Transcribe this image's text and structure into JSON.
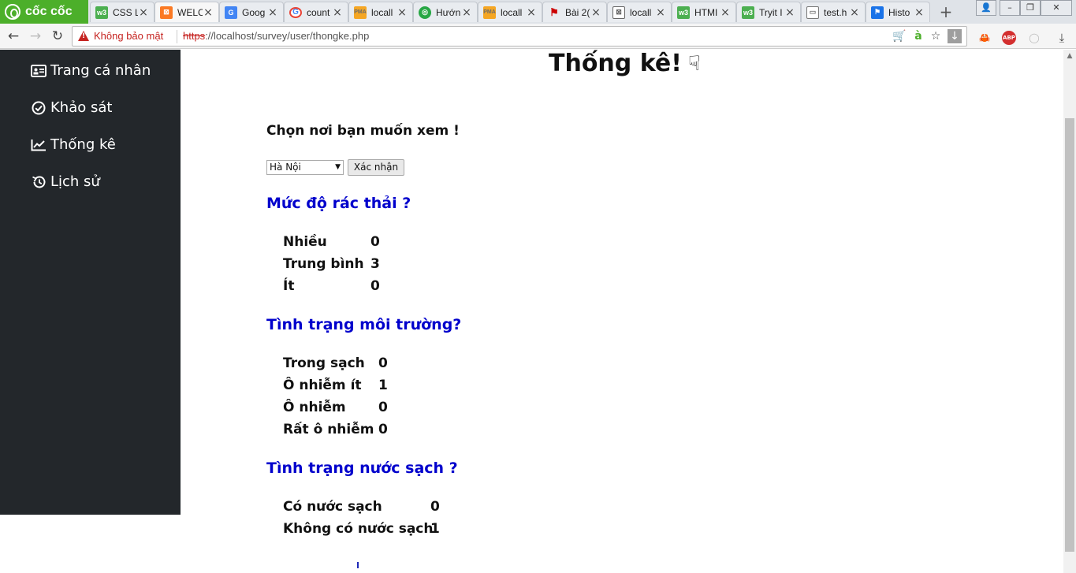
{
  "browser": {
    "brand": "cốc cốc",
    "tabs": [
      {
        "title": "CSS L",
        "favicon": "w3"
      },
      {
        "title": "WELC",
        "favicon": "xampp"
      },
      {
        "title": "Goog",
        "favicon": "gdoc"
      },
      {
        "title": "count",
        "favicon": "google"
      },
      {
        "title": "locall",
        "favicon": "pma"
      },
      {
        "title": "Hướn",
        "favicon": "guide"
      },
      {
        "title": "locall",
        "favicon": "pma"
      },
      {
        "title": "Bài 2(",
        "favicon": "flag-red"
      },
      {
        "title": "locall",
        "favicon": "xbox"
      },
      {
        "title": "HTMI",
        "favicon": "w3"
      },
      {
        "title": "Tryit I",
        "favicon": "w3"
      },
      {
        "title": "test.h",
        "favicon": "doc"
      },
      {
        "title": "Histo",
        "favicon": "flag-blue"
      }
    ],
    "active_tab": 1,
    "security_label": "Không bảo mật",
    "url_scheme": "https",
    "url_rest": "://localhost/survey/user/thongke.php"
  },
  "sidebar": {
    "items": [
      {
        "label": "Trang cá nhân",
        "icon": "id-card-icon"
      },
      {
        "label": "Khảo sát",
        "icon": "check-circle-icon"
      },
      {
        "label": "Thống kê",
        "icon": "line-chart-icon"
      },
      {
        "label": "Lịch sử",
        "icon": "history-icon"
      }
    ]
  },
  "main": {
    "title": "Thống kê!",
    "prompt": "Chọn nơi bạn muốn xem !",
    "location_select": "Hà Nội",
    "confirm_label": "Xác nhận",
    "sections": [
      {
        "title": "Mức độ rác thải ?",
        "rows": [
          {
            "label": "Nhiều",
            "value": "0"
          },
          {
            "label": "Trung bình",
            "value": "3"
          },
          {
            "label": "Ít",
            "value": "0"
          }
        ]
      },
      {
        "title": "Tình trạng môi trường?",
        "rows": [
          {
            "label": "Trong sạch",
            "value": "0"
          },
          {
            "label": "Ô nhiễm ít",
            "value": "1"
          },
          {
            "label": "Ô nhiễm",
            "value": "0"
          },
          {
            "label": "Rất ô nhiễm",
            "value": "0"
          }
        ]
      },
      {
        "title": "Tình trạng nước sạch ?",
        "rows": [
          {
            "label": "Có nước sạch",
            "value": "0"
          },
          {
            "label": "Không có nước sạch",
            "value": "1"
          }
        ]
      }
    ]
  },
  "colors": {
    "sidebar_bg": "#23272b",
    "section_title": "#0000cc",
    "brand_green": "#4caf2a",
    "insecure_red": "#c5221f"
  }
}
